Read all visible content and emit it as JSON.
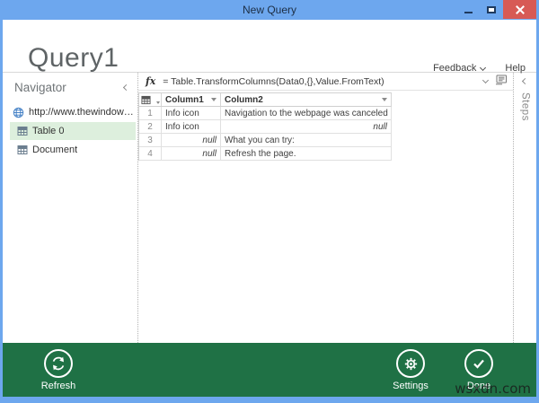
{
  "titlebar": {
    "title": "New Query"
  },
  "header": {
    "title": "Query1",
    "feedback_label": "Feedback",
    "help_label": "Help"
  },
  "navigator": {
    "title": "Navigator",
    "items": [
      {
        "label": "http://www.thewindowsclu...",
        "icon": "globe-icon",
        "selected": false
      },
      {
        "label": "Table 0",
        "icon": "table-icon",
        "selected": true
      },
      {
        "label": "Document",
        "icon": "table-icon",
        "selected": false
      }
    ]
  },
  "formula_bar": {
    "fx": "fx",
    "formula": "= Table.TransformColumns(Data0,{},Value.FromText)"
  },
  "steps_panel": {
    "label": "Steps"
  },
  "grid": {
    "columns": [
      {
        "label": "Column1"
      },
      {
        "label": "Column2"
      }
    ],
    "rows": [
      {
        "num": "1",
        "col1": "Info icon",
        "col2": "Navigation to the webpage was canceled"
      },
      {
        "num": "2",
        "col1": "Info icon",
        "col2": "null"
      },
      {
        "num": "3",
        "col1": "null",
        "col2": "What you can try:"
      },
      {
        "num": "4",
        "col1": "null",
        "col2": "Refresh the page."
      }
    ]
  },
  "footer": {
    "buttons": [
      {
        "label": "Refresh",
        "icon": "refresh-icon"
      },
      {
        "label": "Settings",
        "icon": "gear-icon"
      },
      {
        "label": "Done",
        "icon": "check-icon"
      }
    ]
  },
  "watermark": "wsxdn.com",
  "colors": {
    "titlebar_blue": "#6da7ee",
    "footer_green": "#1f7145",
    "close_red": "#d75a55",
    "selected_item_bg": "#ddefdd",
    "grid_border": "#d2d2d2"
  }
}
